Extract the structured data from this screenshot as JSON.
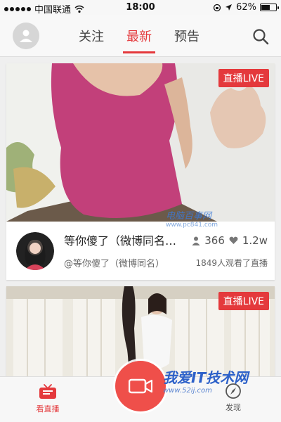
{
  "status_bar": {
    "carrier": "中国联通",
    "time": "18:00",
    "battery_percent": 62,
    "battery": "62%"
  },
  "nav": {
    "tabs": [
      {
        "label": "关注",
        "active": false
      },
      {
        "label": "最新",
        "active": true
      },
      {
        "label": "预告",
        "active": false
      }
    ]
  },
  "feed": [
    {
      "badge": "直播LIVE",
      "title": "等你傻了（微博同名…",
      "handle": "@等你傻了（微博同名）",
      "followers": "366",
      "likes": "1.2w",
      "viewers": "1849人观看了直播"
    },
    {
      "badge": "直播LIVE"
    }
  ],
  "watermarks": {
    "top": "电脑百事网",
    "top_url": "www.pc841.com",
    "bottom": "我爱IT技术网",
    "bottom_url": "www.52ij.com"
  },
  "bottom_bar": {
    "tabs": [
      {
        "label": "看直播",
        "active": true
      },
      {
        "label": "发现",
        "active": false
      }
    ]
  },
  "colors": {
    "accent": "#e4393c",
    "background": "#efefef",
    "record": "#ef4f4a"
  }
}
